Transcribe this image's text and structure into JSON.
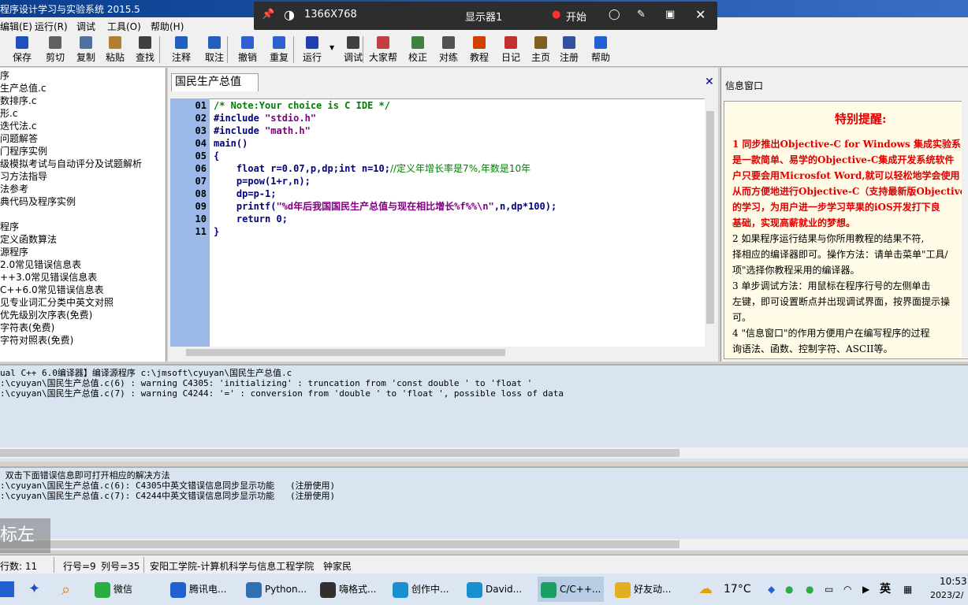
{
  "window": {
    "title": "程序设计学习与实验系统 2015.5"
  },
  "menu": [
    "编辑(E)",
    "运行(R)",
    "调试",
    "工具(O)",
    "帮助(H)"
  ],
  "toolbar": [
    {
      "label": "保存",
      "icon": "save-icon",
      "color": "#2050c0"
    },
    {
      "label": "剪切",
      "icon": "cut-icon",
      "color": "#606060"
    },
    {
      "label": "复制",
      "icon": "copy-icon",
      "color": "#5070a0"
    },
    {
      "label": "粘贴",
      "icon": "paste-icon",
      "color": "#b08030"
    },
    {
      "label": "查找",
      "icon": "find-icon",
      "color": "#404040"
    },
    {
      "label": "注释",
      "icon": "comment-icon",
      "color": "#2060c0"
    },
    {
      "label": "取注",
      "icon": "uncomment-icon",
      "color": "#2060c0"
    },
    {
      "label": "撤销",
      "icon": "undo-icon",
      "color": "#3060d0"
    },
    {
      "label": "重复",
      "icon": "redo-icon",
      "color": "#3060d0"
    },
    {
      "label": "运行",
      "icon": "run-icon",
      "color": "#2040b0"
    },
    {
      "label": "调试",
      "icon": "debug-icon",
      "color": "#404040"
    },
    {
      "label": "大家帮",
      "icon": "community-icon",
      "color": "#c04040"
    },
    {
      "label": "校正",
      "icon": "check-icon",
      "color": "#408040"
    },
    {
      "label": "对练",
      "icon": "practice-icon",
      "color": "#505050"
    },
    {
      "label": "教程",
      "icon": "tutorial-icon",
      "color": "#d04000"
    },
    {
      "label": "日记",
      "icon": "diary-icon",
      "color": "#c03030"
    },
    {
      "label": "主页",
      "icon": "home-icon",
      "color": "#806020"
    },
    {
      "label": "注册",
      "icon": "register-icon",
      "color": "#3050a0"
    },
    {
      "label": "帮助",
      "icon": "help-icon",
      "color": "#2060d0"
    }
  ],
  "recorder": {
    "resolution": "1366X768",
    "monitor": "显示器1",
    "start": "开始"
  },
  "tree": [
    "序",
    "生产总值.c",
    "数排序.c",
    "形.c",
    "迭代法.c",
    "问题解答",
    "门程序实例",
    "级模拟考试与自动评分及试题解析",
    "习方法指导",
    "法参考",
    "典代码及程序实例",
    "",
    "程序",
    "定义函数算法",
    "源程序",
    "2.0常见错误信息表",
    "++3.0常见错误信息表",
    "C++6.0常见错误信息表",
    "见专业词汇分类中英文对照",
    "优先级别次序表(免费)",
    "字符表(免费)",
    "字符对照表(免费)"
  ],
  "editor": {
    "tab": "国民生产总值",
    "line_numbers": [
      "01",
      "02",
      "03",
      "04",
      "05",
      "06",
      "07",
      "08",
      "09",
      "10",
      "11"
    ],
    "lines": {
      "l1": "/* Note:Your choice is C IDE */",
      "l2a": "#include ",
      "l2b": "\"stdio.h\"",
      "l3a": "#include ",
      "l3b": "\"math.h\"",
      "l4": "main()",
      "l5": "{",
      "l6a": "    float r=0.07,p,dp;int n=10;",
      "l6b": "//定义年增长率是7%,年数是10年",
      "l7": "    p=pow(1+r,n);",
      "l8": "    dp=p-1;",
      "l9a": "    printf(",
      "l9b": "\"%d年后我国国民生产总值与现在相比增长%f%%\\n\"",
      "l9c": ",n,dp*100);",
      "l10": "    return 0;",
      "l11": "}"
    }
  },
  "info": {
    "title": "信息窗口",
    "heading": "特别提醒:",
    "p1": [
      "  1 同步推出Objective-C for Windows 集成实验系",
      "是一款简单、易学的Objective-C集成开发系统软件",
      "户只要会用Microsfot Word,就可以轻松地学会使用",
      "从而方便地进行Objective-C（支持最新版Objective-",
      "的学习，为用户进一步学习苹果的iOS开发打下良",
      "基础，实现高薪就业的梦想。"
    ],
    "p2": [
      "  2 如果程序运行结果与你所用教程的结果不符,",
      "择相应的编译器即可。操作方法：请单击菜单\"工具/",
      "项\"选择你教程采用的编译器。"
    ],
    "p3": [
      "  3 单步调试方法：用鼠标在程序行号的左侧单击",
      "左键，即可设置断点并出现调试界面，按界面提示操",
      "可。"
    ],
    "p4": [
      "  4 \"信息窗口\"的作用方便用户在编写程序的过程",
      "询语法、函数、控制字符、ASCII等。"
    ]
  },
  "output": {
    "compile": [
      "ual C++ 6.0编译器】编译源程序 c:\\jmsoft\\cyuyan\\国民生产总值.c",
      ":\\cyuyan\\国民生产总值.c(6) : warning C4305: 'initializing' : truncation from 'const double ' to 'float '",
      ":\\cyuyan\\国民生产总值.c(7) : warning C4244: '=' : conversion from 'double ' to 'float ', possible loss of data"
    ],
    "help": [
      " 双击下面错误信息即可打开相应的解决方法",
      ":\\cyuyan\\国民生产总值.c(6): C4305中英文错误信息同步显示功能   (注册使用)",
      ":\\cyuyan\\国民生产总值.c(7): C4244中英文错误信息同步显示功能   (注册使用)"
    ]
  },
  "watermark": "标左键",
  "status": {
    "lines": "行数:  11",
    "row": "行号=9",
    "col": "列号=35",
    "school": "安阳工学院-计算机科学与信息工程学院",
    "author": "钟家民"
  },
  "taskbar": {
    "apps": [
      {
        "label": "微信",
        "color": "#2aae43"
      },
      {
        "label": "腾讯电...",
        "color": "#2060d0"
      },
      {
        "label": "Python...",
        "color": "#3070b0"
      },
      {
        "label": "嗨格式...",
        "color": "#303030"
      },
      {
        "label": "创作中...",
        "color": "#1a8fd0"
      },
      {
        "label": "David...",
        "color": "#1a8fd0"
      },
      {
        "label": "C/C++...",
        "color": "#1aa060"
      },
      {
        "label": "好友动...",
        "color": "#e0b020"
      }
    ],
    "weather": "17°C",
    "ime": "英",
    "time": "10:53",
    "date": "2023/2/"
  }
}
